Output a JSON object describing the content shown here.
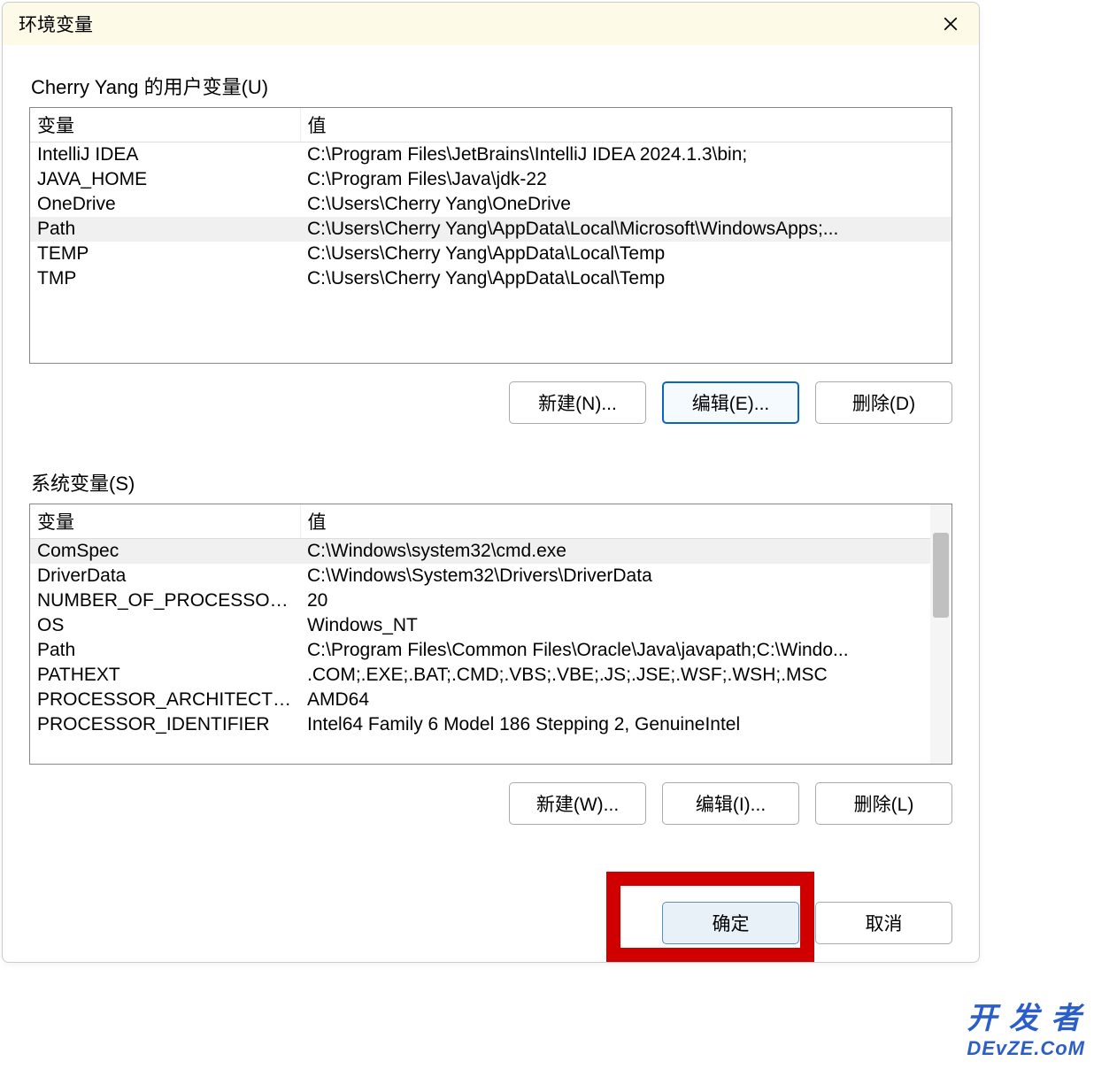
{
  "dialog": {
    "title": "环境变量"
  },
  "user_section": {
    "label": "Cherry Yang 的用户变量(U)",
    "columns": {
      "var": "变量",
      "val": "值"
    },
    "rows": [
      {
        "var": "IntelliJ IDEA",
        "val": "C:\\Program Files\\JetBrains\\IntelliJ IDEA 2024.1.3\\bin;",
        "selected": false
      },
      {
        "var": "JAVA_HOME",
        "val": "C:\\Program Files\\Java\\jdk-22",
        "selected": false
      },
      {
        "var": "OneDrive",
        "val": "C:\\Users\\Cherry Yang\\OneDrive",
        "selected": false
      },
      {
        "var": "Path",
        "val": "C:\\Users\\Cherry Yang\\AppData\\Local\\Microsoft\\WindowsApps;...",
        "selected": true
      },
      {
        "var": "TEMP",
        "val": "C:\\Users\\Cherry Yang\\AppData\\Local\\Temp",
        "selected": false
      },
      {
        "var": "TMP",
        "val": "C:\\Users\\Cherry Yang\\AppData\\Local\\Temp",
        "selected": false
      }
    ],
    "buttons": {
      "new": "新建(N)...",
      "edit": "编辑(E)...",
      "delete": "删除(D)"
    }
  },
  "system_section": {
    "label": "系统变量(S)",
    "columns": {
      "var": "变量",
      "val": "值"
    },
    "rows": [
      {
        "var": "ComSpec",
        "val": "C:\\Windows\\system32\\cmd.exe",
        "selected": true
      },
      {
        "var": "DriverData",
        "val": "C:\\Windows\\System32\\Drivers\\DriverData",
        "selected": false
      },
      {
        "var": "NUMBER_OF_PROCESSORS",
        "val": "20",
        "selected": false
      },
      {
        "var": "OS",
        "val": "Windows_NT",
        "selected": false
      },
      {
        "var": "Path",
        "val": "C:\\Program Files\\Common Files\\Oracle\\Java\\javapath;C:\\Windo...",
        "selected": false
      },
      {
        "var": "PATHEXT",
        "val": ".COM;.EXE;.BAT;.CMD;.VBS;.VBE;.JS;.JSE;.WSF;.WSH;.MSC",
        "selected": false
      },
      {
        "var": "PROCESSOR_ARCHITECTU...",
        "val": "AMD64",
        "selected": false
      },
      {
        "var": "PROCESSOR_IDENTIFIER",
        "val": "Intel64 Family 6 Model 186 Stepping 2, GenuineIntel",
        "selected": false
      }
    ],
    "buttons": {
      "new": "新建(W)...",
      "edit": "编辑(I)...",
      "delete": "删除(L)"
    }
  },
  "bottom": {
    "ok": "确定",
    "cancel": "取消"
  },
  "watermark": "开发者\nDEvZE.CoM"
}
